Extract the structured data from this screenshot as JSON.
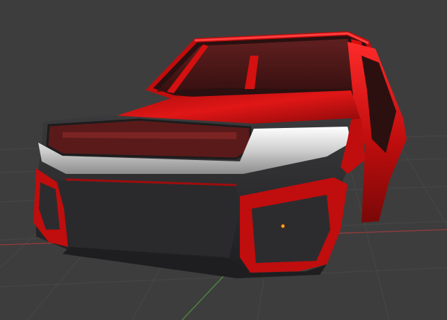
{
  "viewport": {
    "background_color": "#3d3d3d",
    "grid_color": "#474747",
    "x_axis_color": "#9a3b3b",
    "y_axis_color": "#4f8a3a",
    "origin_color": "#ff9b2a"
  },
  "model": {
    "body_color": "#c00d0d",
    "body_highlight_color": "#ff2a2a",
    "trim_color": "#2a2a2c",
    "chrome_color": "#cfcfcf",
    "glass_color": "#5a1a1a"
  }
}
